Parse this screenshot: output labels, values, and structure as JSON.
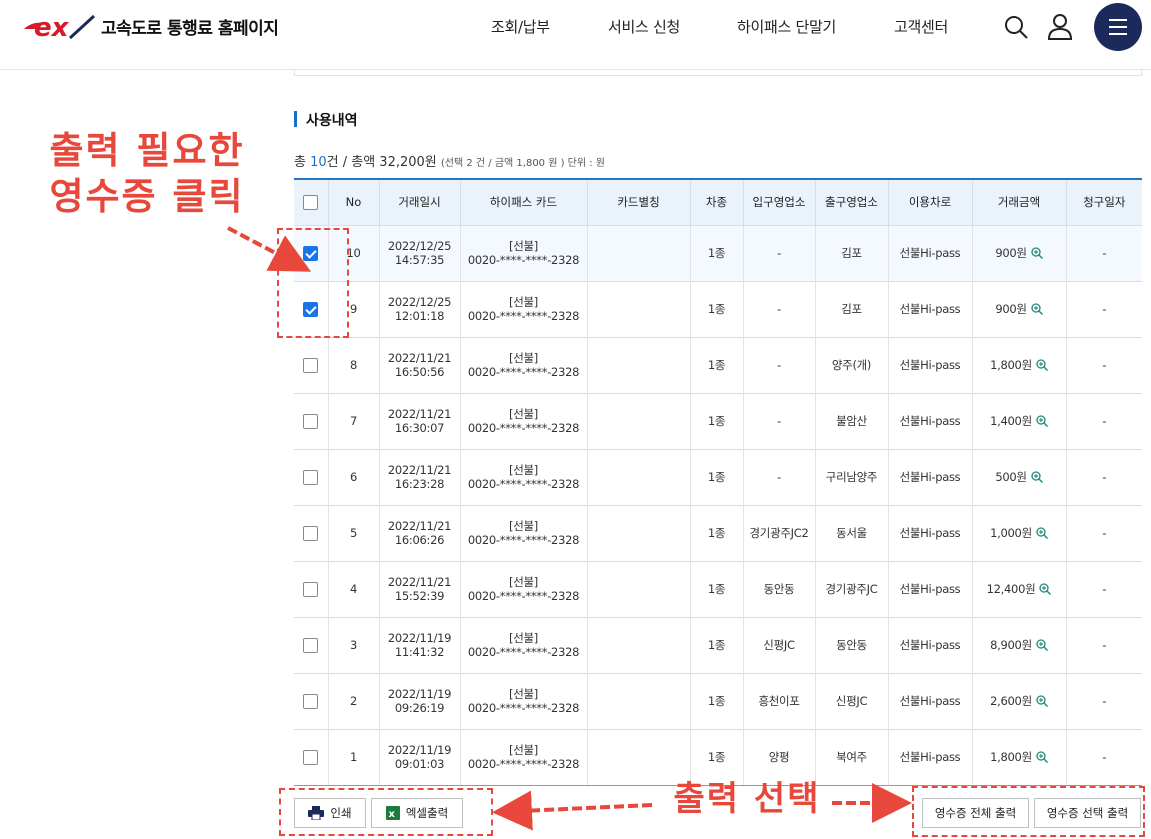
{
  "header": {
    "site_title": "고속도로 통행료 홈페이지",
    "nav": [
      "조회/납부",
      "서비스 신청",
      "하이패스 단말기",
      "고객센터"
    ],
    "brand_color": "#d7192a",
    "menu_color": "#1b2a5a"
  },
  "section": {
    "title": "사용내역"
  },
  "summary": {
    "prefix": "총 ",
    "count": "10",
    "count_unit": "건 / 총액 32,200원",
    "detail": "(선택 2 건 / 금액 1,800 원 ) 단위 : 원"
  },
  "table": {
    "headers": [
      "No",
      "거래일시",
      "하이패스 카드",
      "카드별칭",
      "차종",
      "입구영업소",
      "출구영업소",
      "이용차로",
      "거래금액",
      "청구일자"
    ],
    "rows": [
      {
        "checked": true,
        "no": "10",
        "date": "2022/12/25",
        "time": "14:57:35",
        "card_type": "[선불]",
        "card_no": "0020-****-****-2328",
        "alias": "",
        "vehicle": "1종",
        "entry": "-",
        "exit": "김포",
        "lane": "선불Hi-pass",
        "amount": "900원",
        "billing": "-"
      },
      {
        "checked": true,
        "no": "9",
        "date": "2022/12/25",
        "time": "12:01:18",
        "card_type": "[선불]",
        "card_no": "0020-****-****-2328",
        "alias": "",
        "vehicle": "1종",
        "entry": "-",
        "exit": "김포",
        "lane": "선불Hi-pass",
        "amount": "900원",
        "billing": "-"
      },
      {
        "checked": false,
        "no": "8",
        "date": "2022/11/21",
        "time": "16:50:56",
        "card_type": "[선불]",
        "card_no": "0020-****-****-2328",
        "alias": "",
        "vehicle": "1종",
        "entry": "-",
        "exit": "양주(개)",
        "lane": "선불Hi-pass",
        "amount": "1,800원",
        "billing": "-"
      },
      {
        "checked": false,
        "no": "7",
        "date": "2022/11/21",
        "time": "16:30:07",
        "card_type": "[선불]",
        "card_no": "0020-****-****-2328",
        "alias": "",
        "vehicle": "1종",
        "entry": "-",
        "exit": "불암산",
        "lane": "선불Hi-pass",
        "amount": "1,400원",
        "billing": "-"
      },
      {
        "checked": false,
        "no": "6",
        "date": "2022/11/21",
        "time": "16:23:28",
        "card_type": "[선불]",
        "card_no": "0020-****-****-2328",
        "alias": "",
        "vehicle": "1종",
        "entry": "-",
        "exit": "구리남양주",
        "lane": "선불Hi-pass",
        "amount": "500원",
        "billing": "-"
      },
      {
        "checked": false,
        "no": "5",
        "date": "2022/11/21",
        "time": "16:06:26",
        "card_type": "[선불]",
        "card_no": "0020-****-****-2328",
        "alias": "",
        "vehicle": "1종",
        "entry": "경기광주JC2",
        "exit": "동서울",
        "lane": "선불Hi-pass",
        "amount": "1,000원",
        "billing": "-"
      },
      {
        "checked": false,
        "no": "4",
        "date": "2022/11/21",
        "time": "15:52:39",
        "card_type": "[선불]",
        "card_no": "0020-****-****-2328",
        "alias": "",
        "vehicle": "1종",
        "entry": "동안동",
        "exit": "경기광주JC",
        "lane": "선불Hi-pass",
        "amount": "12,400원",
        "billing": "-"
      },
      {
        "checked": false,
        "no": "3",
        "date": "2022/11/19",
        "time": "11:41:32",
        "card_type": "[선불]",
        "card_no": "0020-****-****-2328",
        "alias": "",
        "vehicle": "1종",
        "entry": "신평JC",
        "exit": "동안동",
        "lane": "선불Hi-pass",
        "amount": "8,900원",
        "billing": "-"
      },
      {
        "checked": false,
        "no": "2",
        "date": "2022/11/19",
        "time": "09:26:19",
        "card_type": "[선불]",
        "card_no": "0020-****-****-2328",
        "alias": "",
        "vehicle": "1종",
        "entry": "흥천이포",
        "exit": "신평JC",
        "lane": "선불Hi-pass",
        "amount": "2,600원",
        "billing": "-"
      },
      {
        "checked": false,
        "no": "1",
        "date": "2022/11/19",
        "time": "09:01:03",
        "card_type": "[선불]",
        "card_no": "0020-****-****-2328",
        "alias": "",
        "vehicle": "1종",
        "entry": "양평",
        "exit": "북여주",
        "lane": "선불Hi-pass",
        "amount": "1,800원",
        "billing": "-"
      }
    ]
  },
  "buttons": {
    "print": "인쇄",
    "excel": "엑셀출력",
    "receipt_all": "영수증 전체 출력",
    "receipt_selected": "영수증 선택 출력"
  },
  "annotations": {
    "click_note_line1": "출력 필요한",
    "click_note_line2": "영수증 클릭",
    "select_note": "출력 선택",
    "color": "#e8473b"
  }
}
